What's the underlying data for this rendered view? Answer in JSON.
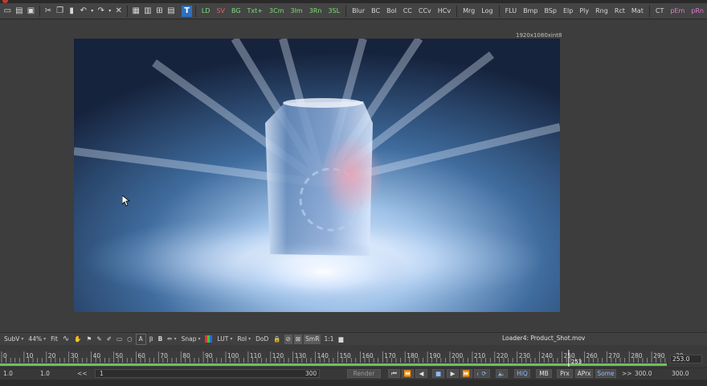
{
  "toolbar": {
    "tools": [
      "LD",
      "SV",
      "BG",
      "Txt+",
      "3Cm",
      "3Im",
      "3Rn",
      "3SL",
      "Blur",
      "BC",
      "Bol",
      "CC",
      "CCv",
      "HCv",
      "Mrg",
      "Log",
      "FLU",
      "Bmp",
      "BSp",
      "Elp",
      "Ply",
      "Rng",
      "Rct",
      "Mat",
      "CT",
      "pEm",
      "pRn"
    ],
    "tool_colors": {
      "LD": "#7ddc7d",
      "SV": "#e06060",
      "BG": "#7ddc7d",
      "Txt+": "#7ddc7d",
      "3Cm": "#7ddc7d",
      "3Im": "#7ddc7d",
      "3Rn": "#7ddc7d",
      "3SL": "#7ddc7d",
      "pEm": "#e07ad0",
      "pRn": "#e07ad0"
    },
    "active_tool_icon": "fusion-t-icon"
  },
  "viewer": {
    "resolution": "1920x1080xint8",
    "loader_name": "Loader4: Product_Shot.mov"
  },
  "view_toolbar": {
    "subview": "SubV",
    "zoom": "44%",
    "fit": "Fit",
    "snap": "Snap",
    "lut": "LUT",
    "roi": "RoI",
    "dod": "DoD",
    "smr": "SmR",
    "ratio": "1:1"
  },
  "ruler": {
    "ticks": [
      "0",
      "10",
      "20",
      "30",
      "40",
      "50",
      "60",
      "70",
      "80",
      "90",
      "100",
      "110",
      "120",
      "130",
      "140",
      "150",
      "160",
      "170",
      "180",
      "190",
      "200",
      "210",
      "220",
      "230",
      "240",
      "250",
      "260",
      "270",
      "280",
      "290",
      "30"
    ],
    "current_frame": "253",
    "current_frame_field": "253.0"
  },
  "timebar": {
    "global_start": "1.0",
    "render_start": "1.0",
    "nav_left": "<<",
    "range_start": "1",
    "range_end": "300",
    "render": "Render",
    "hiq": "HiQ",
    "mb": "MB",
    "prx": "Prx",
    "aprx": "APrx",
    "some": "Some",
    "nav_right": ">>",
    "render_end": "300.0",
    "global_end": "300.0"
  }
}
